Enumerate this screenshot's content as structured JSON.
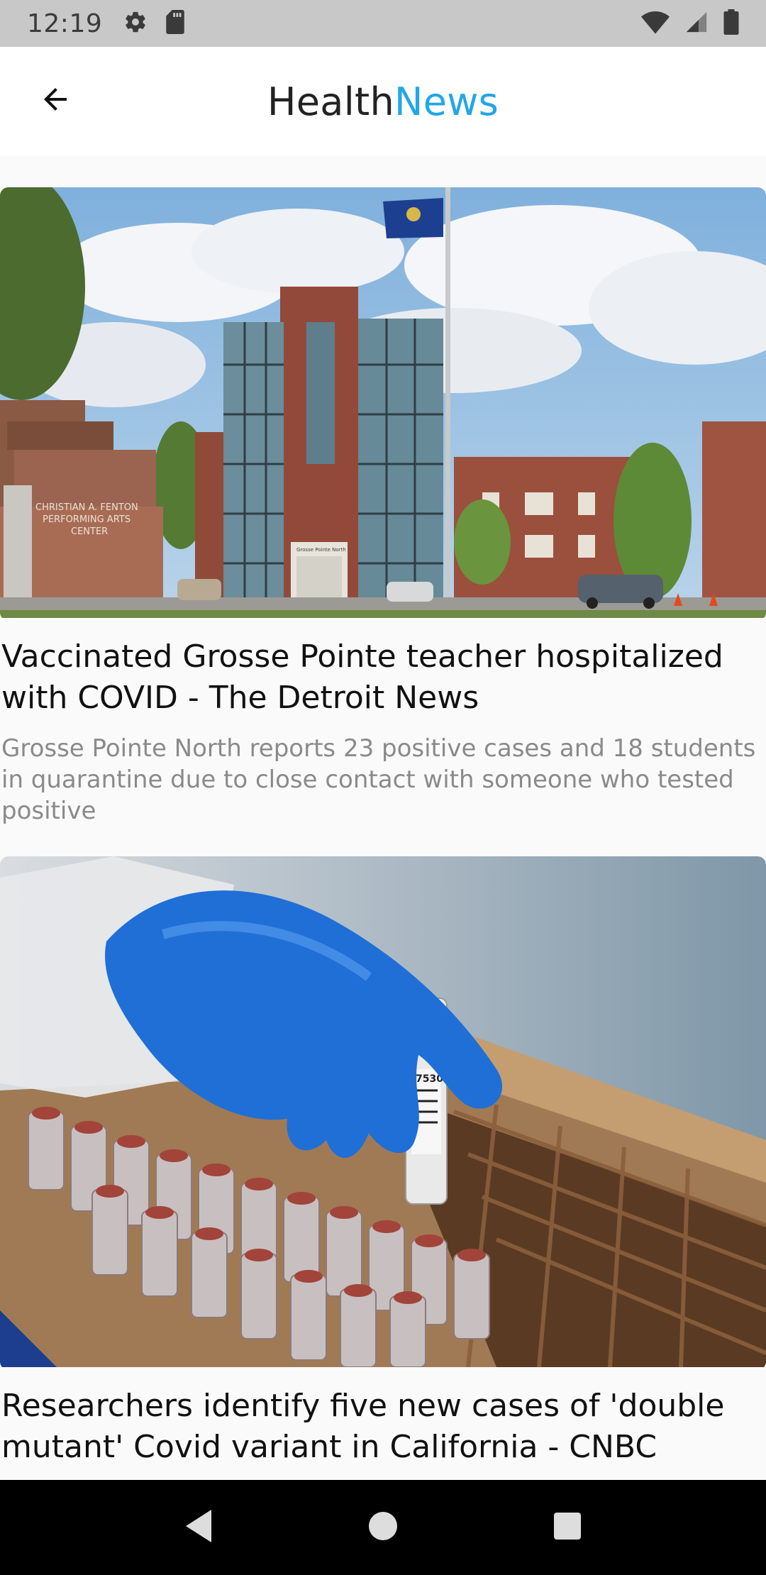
{
  "status_bar": {
    "time": "12:19",
    "icons": [
      "settings-icon",
      "sd-card-icon",
      "wifi-icon",
      "signal-icon",
      "battery-icon"
    ]
  },
  "app_bar": {
    "title_part1": "Health",
    "title_part2": "News",
    "title_color": "#222222",
    "accent_color": "#22a6e8",
    "back_icon": "arrow-left-icon"
  },
  "articles": [
    {
      "title": "Vaccinated Grosse Pointe teacher hospitalized with COVID - The Detroit News",
      "description": "Grosse Pointe North reports 23 positive cases and 18 students in quarantine due to close contact with someone who tested positive",
      "image": "school-building-photo",
      "image_sign_line1": "CHRISTIAN A. FENTON",
      "image_sign_line2": "PERFORMING ARTS",
      "image_sign_line3": "CENTER",
      "image_sign_door": "Grosse Pointe North"
    },
    {
      "title": "Researchers identify five new cases of 'double mutant' Covid variant in California - CNBC",
      "description": "",
      "image": "lab-test-tubes-photo",
      "image_tube_label": "7530"
    }
  ],
  "nav_bar": {
    "buttons": [
      "back-triangle-icon",
      "home-circle-icon",
      "recents-square-icon"
    ]
  }
}
